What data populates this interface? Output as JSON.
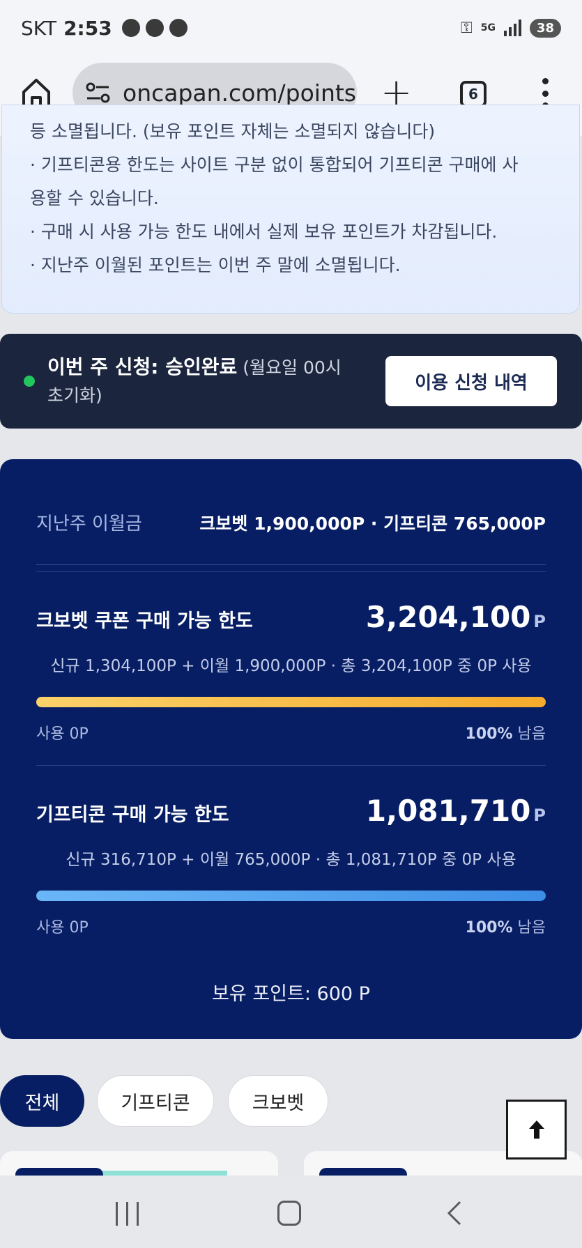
{
  "status_bar": {
    "carrier": "SKT",
    "time": "2:53",
    "network": "5G",
    "battery": "38"
  },
  "browser": {
    "url": "oncapan.com/points",
    "tab_count": "6"
  },
  "notice": {
    "cut_line": "등 소멸됩니다. (보유 포인트 자체는 소멸되지 않습니다)",
    "line1": "· 기프티콘용 한도는 사이트 구분 없이 통합되어 기프티콘 구매에 사",
    "line1b": "용할 수 있습니다.",
    "line2": "· 구매 시 사용 가능 한도 내에서 실제 보유 포인트가 차감됩니다.",
    "line3": "· 지난주 이월된 포인트는 이번 주 말에 소멸됩니다."
  },
  "weekly_status": {
    "title": "이번 주 신청: 승인완료",
    "note": "(월요일 00시 초기화)",
    "history_button": "이용 신청 내역",
    "status_color": "#22c55e"
  },
  "points": {
    "carryover_label": "지난주 이월금",
    "carryover_value": "크보벳 1,900,000P · 기프티콘 765,000P",
    "krbet": {
      "name": "크보벳 쿠폰 구매 가능 한도",
      "amount": "3,204,100",
      "unit": "P",
      "desc": "신규 1,304,100P + 이월 1,900,000P · 총 3,204,100P 중 0P 사용",
      "used": "사용 0P",
      "remaining_pct": "100%",
      "remaining_label": "남음",
      "remaining_fraction": 1.0
    },
    "gift": {
      "name": "기프티콘 구매 가능 한도",
      "amount": "1,081,710",
      "unit": "P",
      "desc": "신규 316,710P + 이월 765,000P · 총 1,081,710P 중 0P 사용",
      "used": "사용 0P",
      "remaining_pct": "100%",
      "remaining_label": "남음",
      "remaining_fraction": 1.0
    },
    "holdings": "보유 포인트: 600 P"
  },
  "filters": {
    "all": "전체",
    "gift": "기프티콘",
    "krbet": "크보벳",
    "selected": "전체"
  },
  "colors": {
    "card_bg": "#071e64",
    "strip_bg": "#1b253d",
    "krbet_bar": "#f5ab2d",
    "gift_bar": "#3c8ee6"
  }
}
